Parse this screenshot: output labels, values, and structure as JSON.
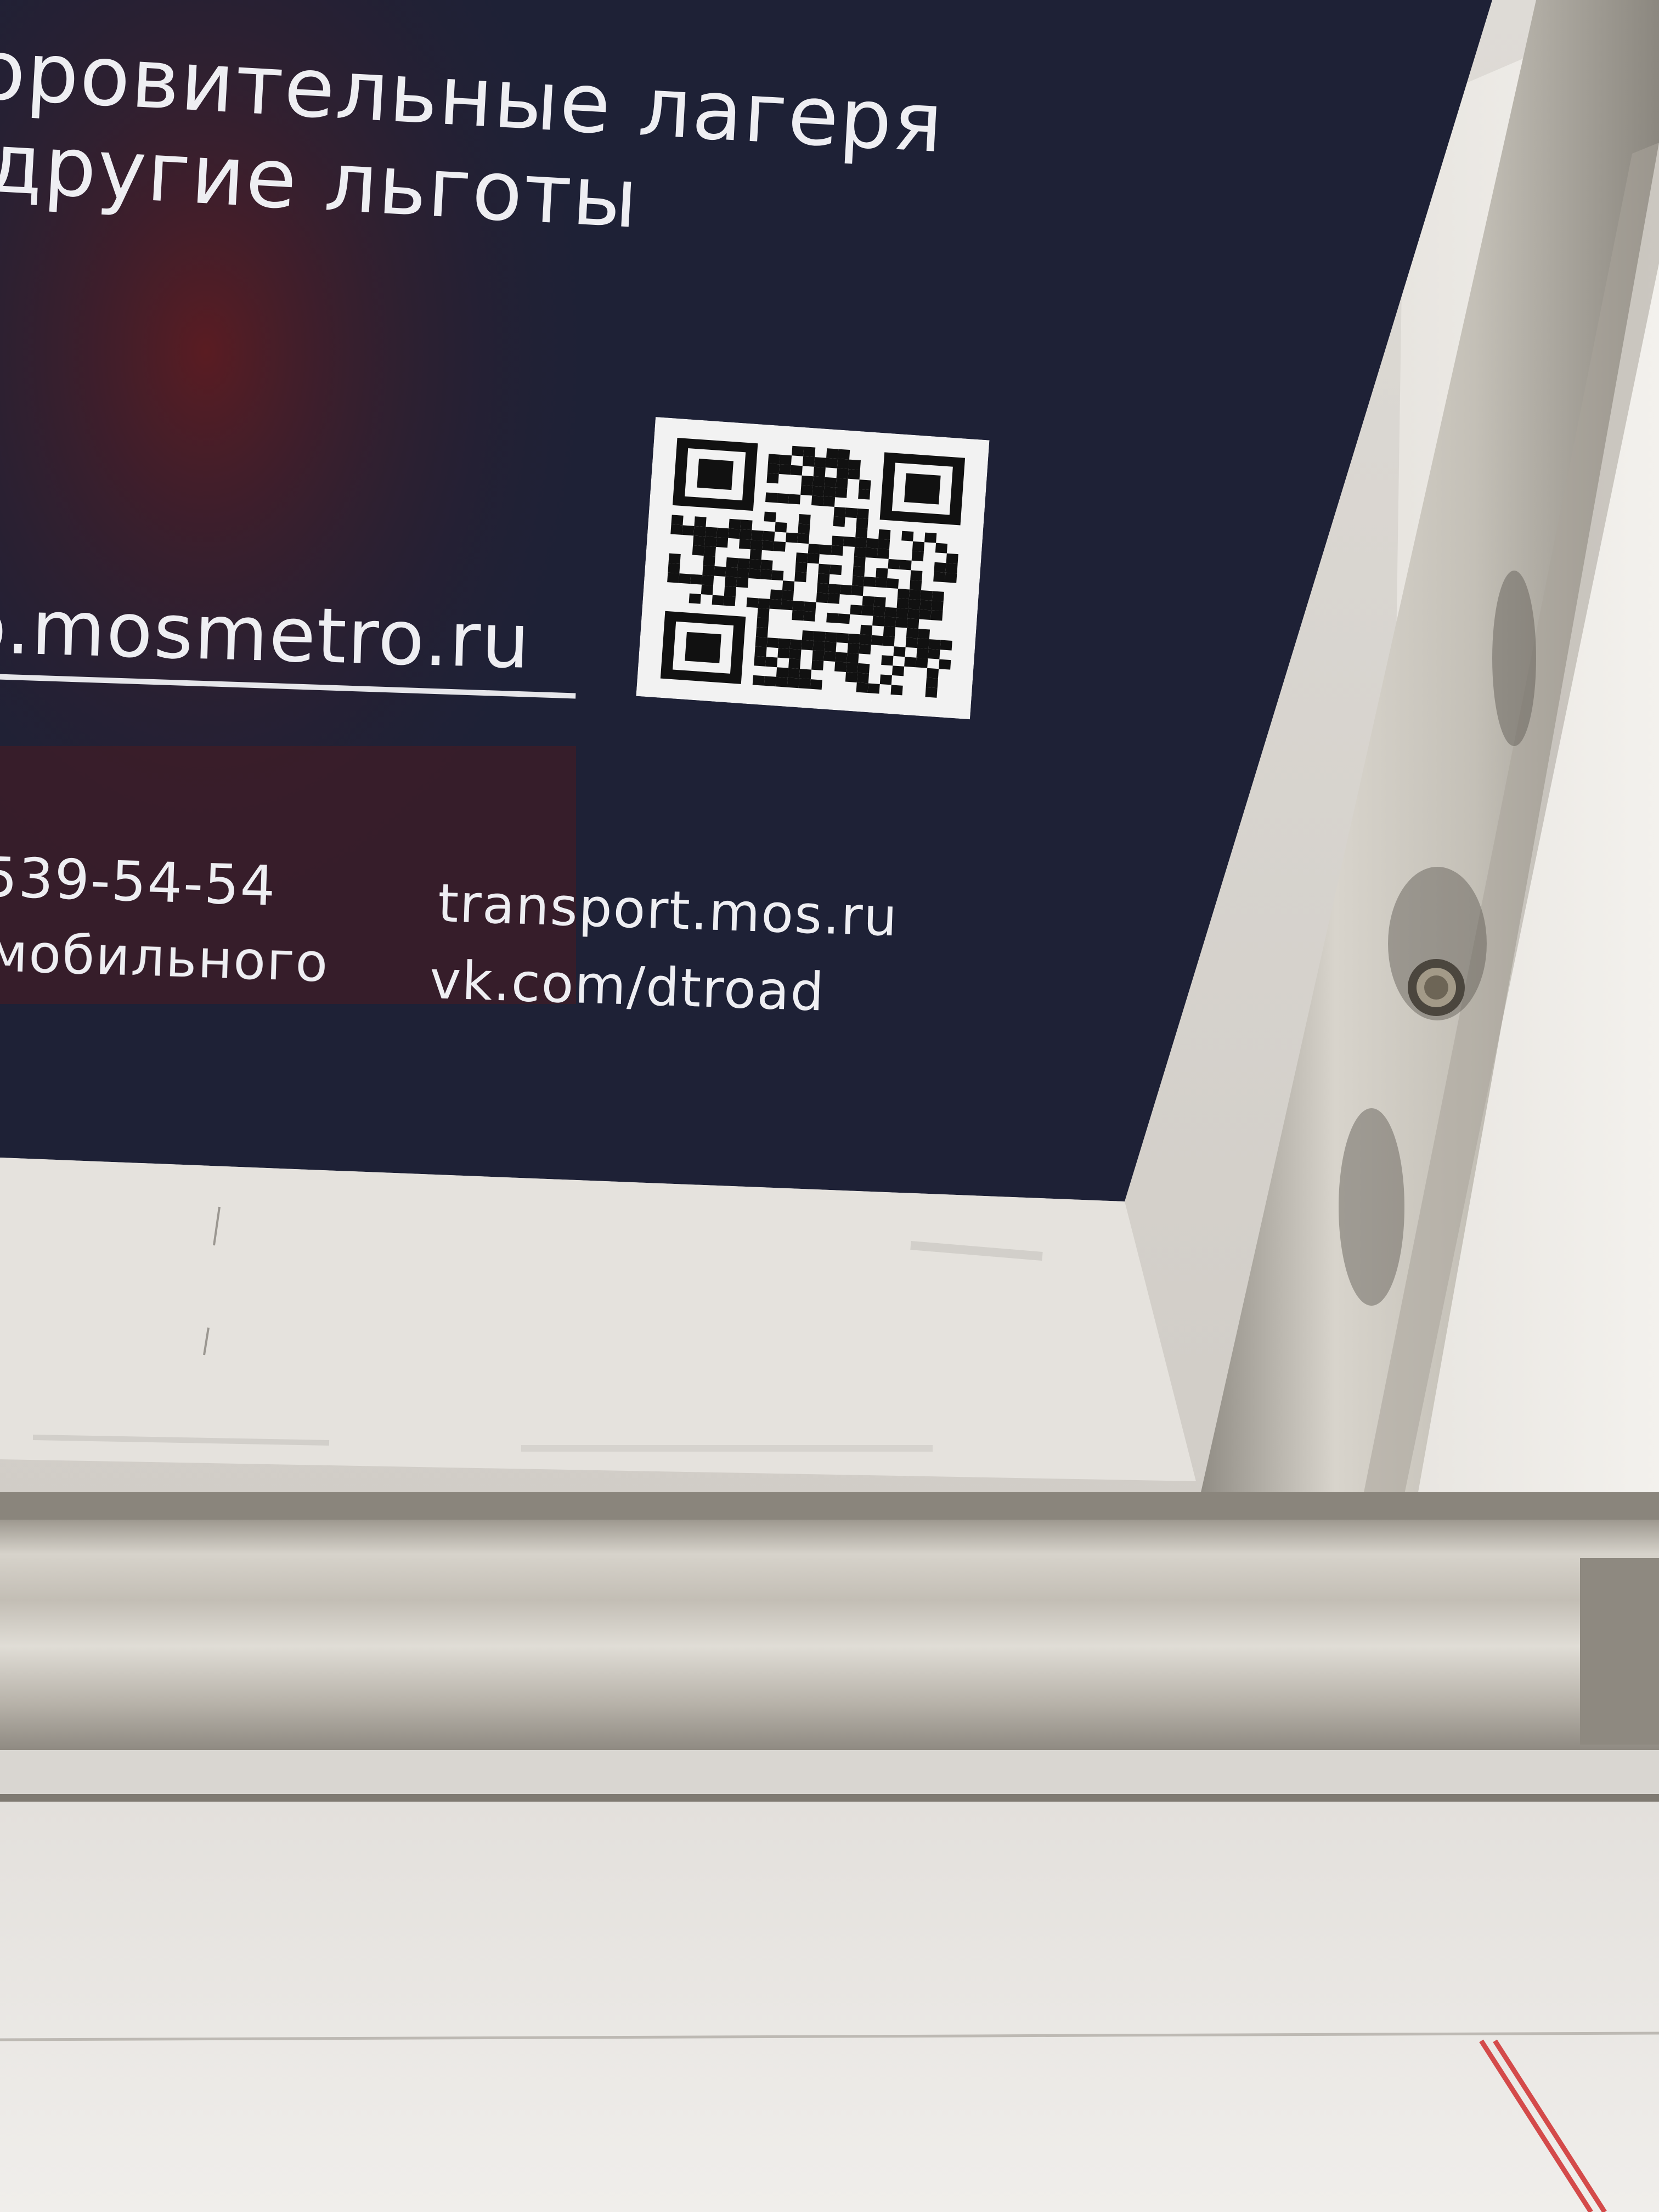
{
  "poster": {
    "line1": "оровительные лагеря",
    "line2": "другие льготы",
    "website": "o.mosmetro.ru",
    "phone": "539-54-54",
    "phone_note": "мобильного",
    "link1": "transport.mos.ru",
    "link2": "vk.com/dtroad"
  },
  "colors": {
    "poster_background": "#1e2136",
    "poster_text": "#eeeef2",
    "panel": "#e9e6e1",
    "metal_frame": "#c8c4bc",
    "stripe": "#d44a4a"
  },
  "icons": {
    "qr": "qr-code",
    "screw": "screw-head"
  }
}
